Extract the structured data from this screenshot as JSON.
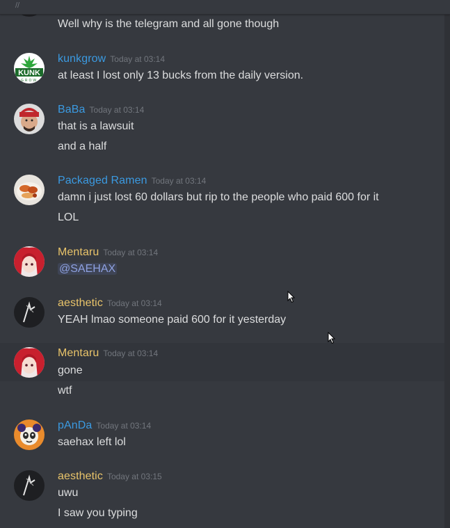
{
  "colors": {
    "background": "#36393f",
    "hover_background": "#32353b",
    "message_text": "#dcddde",
    "timestamp": "#72767d",
    "name_blue": "#3b9ae1",
    "name_gold": "#e9c46a",
    "mention_text": "#8ea1e1"
  },
  "messages": [
    {
      "author": "",
      "timestamp": "",
      "lines": [
        "Well why is the telegram and all gone though"
      ]
    },
    {
      "author": "kunkgrow",
      "timestamp": "Today at 03:14",
      "lines": [
        "at least I lost only 13 bucks from the daily version."
      ]
    },
    {
      "author": "BaBa",
      "timestamp": "Today at 03:14",
      "lines": [
        "that is a lawsuit",
        "and a half"
      ]
    },
    {
      "author": "Packaged Ramen",
      "timestamp": "Today at 03:14",
      "lines": [
        "damn i just lost 60 dollars but rip to the people who paid 600 for it",
        "LOL"
      ]
    },
    {
      "author": "Mentaru",
      "timestamp": "Today at 03:14",
      "lines": [
        "@SAEHAX"
      ]
    },
    {
      "author": "aesthetic",
      "timestamp": "Today at 03:14",
      "lines": [
        "YEAH lmao someone paid 600 for it yesterday"
      ]
    },
    {
      "author": "Mentaru",
      "timestamp": "Today at 03:14",
      "lines": [
        "gone",
        "wtf"
      ]
    },
    {
      "author": "pAnDa",
      "timestamp": "Today at 03:14",
      "lines": [
        "saehax left lol"
      ]
    },
    {
      "author": "aesthetic",
      "timestamp": "Today at 03:15",
      "lines": [
        "uwu",
        "I saw you typing"
      ]
    }
  ],
  "avatars": {
    "kunkgrow_logo_text": "KUNK",
    "kunkgrow_logo_subtext": "GROW"
  }
}
